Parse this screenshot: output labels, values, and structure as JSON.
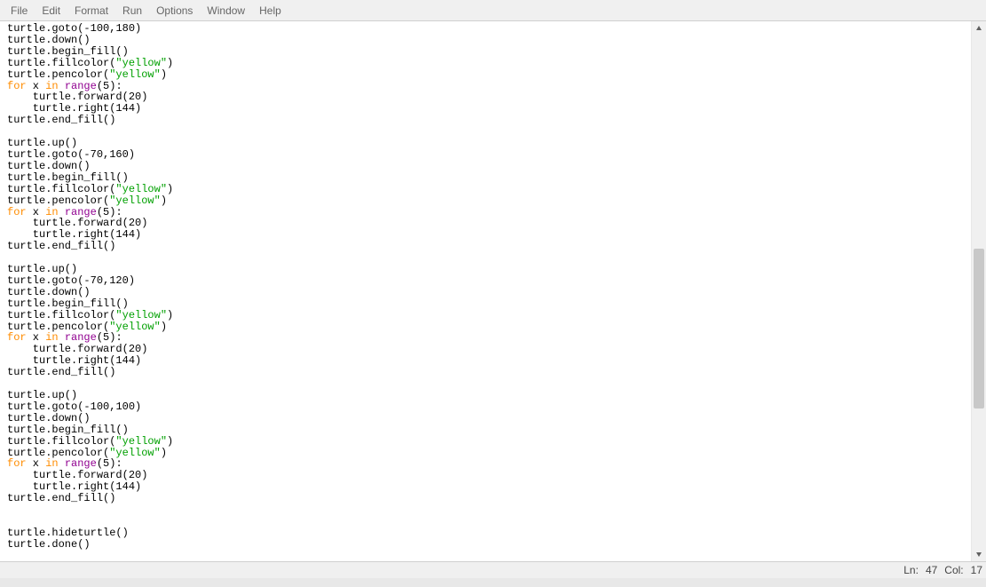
{
  "menu": {
    "file": "File",
    "edit": "Edit",
    "format": "Format",
    "run": "Run",
    "options": "Options",
    "window": "Window",
    "help": "Help"
  },
  "status": {
    "ln_label": "Ln:",
    "ln": "47",
    "col_label": "Col:",
    "col": "17"
  },
  "code": {
    "tokens": [
      [
        {
          "t": "turtle.goto(-"
        },
        {
          "cls": "",
          "t": "100"
        },
        {
          "t": ","
        },
        {
          "cls": "",
          "t": "180"
        },
        {
          "t": ")"
        }
      ],
      [
        {
          "t": "turtle.down()"
        }
      ],
      [
        {
          "t": "turtle.begin_fill()"
        }
      ],
      [
        {
          "t": "turtle.fillcolor("
        },
        {
          "cls": "st",
          "t": "\"yellow\""
        },
        {
          "t": ")"
        }
      ],
      [
        {
          "t": "turtle.pencolor("
        },
        {
          "cls": "st",
          "t": "\"yellow\""
        },
        {
          "t": ")"
        }
      ],
      [
        {
          "cls": "kw",
          "t": "for"
        },
        {
          "t": " x "
        },
        {
          "cls": "kw",
          "t": "in"
        },
        {
          "t": " "
        },
        {
          "cls": "bi",
          "t": "range"
        },
        {
          "t": "("
        },
        {
          "t": "5"
        },
        {
          "t": "):"
        }
      ],
      [
        {
          "t": "    turtle.forward("
        },
        {
          "t": "20"
        },
        {
          "t": ")"
        }
      ],
      [
        {
          "t": "    turtle.right("
        },
        {
          "t": "144"
        },
        {
          "t": ")"
        }
      ],
      [
        {
          "t": "turtle.end_fill()"
        }
      ],
      [
        {
          "t": ""
        }
      ],
      [
        {
          "t": "turtle.up()"
        }
      ],
      [
        {
          "t": "turtle.goto(-"
        },
        {
          "t": "70"
        },
        {
          "t": ","
        },
        {
          "t": "160"
        },
        {
          "t": ")"
        }
      ],
      [
        {
          "t": "turtle.down()"
        }
      ],
      [
        {
          "t": "turtle.begin_fill()"
        }
      ],
      [
        {
          "t": "turtle.fillcolor("
        },
        {
          "cls": "st",
          "t": "\"yellow\""
        },
        {
          "t": ")"
        }
      ],
      [
        {
          "t": "turtle.pencolor("
        },
        {
          "cls": "st",
          "t": "\"yellow\""
        },
        {
          "t": ")"
        }
      ],
      [
        {
          "cls": "kw",
          "t": "for"
        },
        {
          "t": " x "
        },
        {
          "cls": "kw",
          "t": "in"
        },
        {
          "t": " "
        },
        {
          "cls": "bi",
          "t": "range"
        },
        {
          "t": "("
        },
        {
          "t": "5"
        },
        {
          "t": "):"
        }
      ],
      [
        {
          "t": "    turtle.forward("
        },
        {
          "t": "20"
        },
        {
          "t": ")"
        }
      ],
      [
        {
          "t": "    turtle.right("
        },
        {
          "t": "144"
        },
        {
          "t": ")"
        }
      ],
      [
        {
          "t": "turtle.end_fill()"
        }
      ],
      [
        {
          "t": ""
        }
      ],
      [
        {
          "t": "turtle.up()"
        }
      ],
      [
        {
          "t": "turtle.goto(-"
        },
        {
          "t": "70"
        },
        {
          "t": ","
        },
        {
          "t": "120"
        },
        {
          "t": ")"
        }
      ],
      [
        {
          "t": "turtle.down()"
        }
      ],
      [
        {
          "t": "turtle.begin_fill()"
        }
      ],
      [
        {
          "t": "turtle.fillcolor("
        },
        {
          "cls": "st",
          "t": "\"yellow\""
        },
        {
          "t": ")"
        }
      ],
      [
        {
          "t": "turtle.pencolor("
        },
        {
          "cls": "st",
          "t": "\"yellow\""
        },
        {
          "t": ")"
        }
      ],
      [
        {
          "cls": "kw",
          "t": "for"
        },
        {
          "t": " x "
        },
        {
          "cls": "kw",
          "t": "in"
        },
        {
          "t": " "
        },
        {
          "cls": "bi",
          "t": "range"
        },
        {
          "t": "("
        },
        {
          "t": "5"
        },
        {
          "t": "):"
        }
      ],
      [
        {
          "t": "    turtle.forward("
        },
        {
          "t": "20"
        },
        {
          "t": ")"
        }
      ],
      [
        {
          "t": "    turtle.right("
        },
        {
          "t": "144"
        },
        {
          "t": ")"
        }
      ],
      [
        {
          "t": "turtle.end_fill()"
        }
      ],
      [
        {
          "t": ""
        }
      ],
      [
        {
          "t": "turtle.up()"
        }
      ],
      [
        {
          "t": "turtle.goto(-"
        },
        {
          "t": "100"
        },
        {
          "t": ","
        },
        {
          "t": "100"
        },
        {
          "t": ")"
        }
      ],
      [
        {
          "t": "turtle.down()"
        }
      ],
      [
        {
          "t": "turtle.begin_fill()"
        }
      ],
      [
        {
          "t": "turtle.fillcolor("
        },
        {
          "cls": "st",
          "t": "\"yellow\""
        },
        {
          "t": ")"
        }
      ],
      [
        {
          "t": "turtle.pencolor("
        },
        {
          "cls": "st",
          "t": "\"yellow\""
        },
        {
          "t": ")"
        }
      ],
      [
        {
          "cls": "kw",
          "t": "for"
        },
        {
          "t": " x "
        },
        {
          "cls": "kw",
          "t": "in"
        },
        {
          "t": " "
        },
        {
          "cls": "bi",
          "t": "range"
        },
        {
          "t": "("
        },
        {
          "t": "5"
        },
        {
          "t": "):"
        }
      ],
      [
        {
          "t": "    turtle.forward("
        },
        {
          "t": "20"
        },
        {
          "t": ")"
        }
      ],
      [
        {
          "t": "    turtle.right("
        },
        {
          "t": "144"
        },
        {
          "t": ")"
        }
      ],
      [
        {
          "t": "turtle.end_fill()"
        }
      ],
      [
        {
          "t": ""
        }
      ],
      [
        {
          "t": ""
        }
      ],
      [
        {
          "t": "turtle.hideturtle()"
        }
      ],
      [
        {
          "t": "turtle.done()"
        }
      ],
      [
        {
          "t": ""
        }
      ]
    ]
  }
}
